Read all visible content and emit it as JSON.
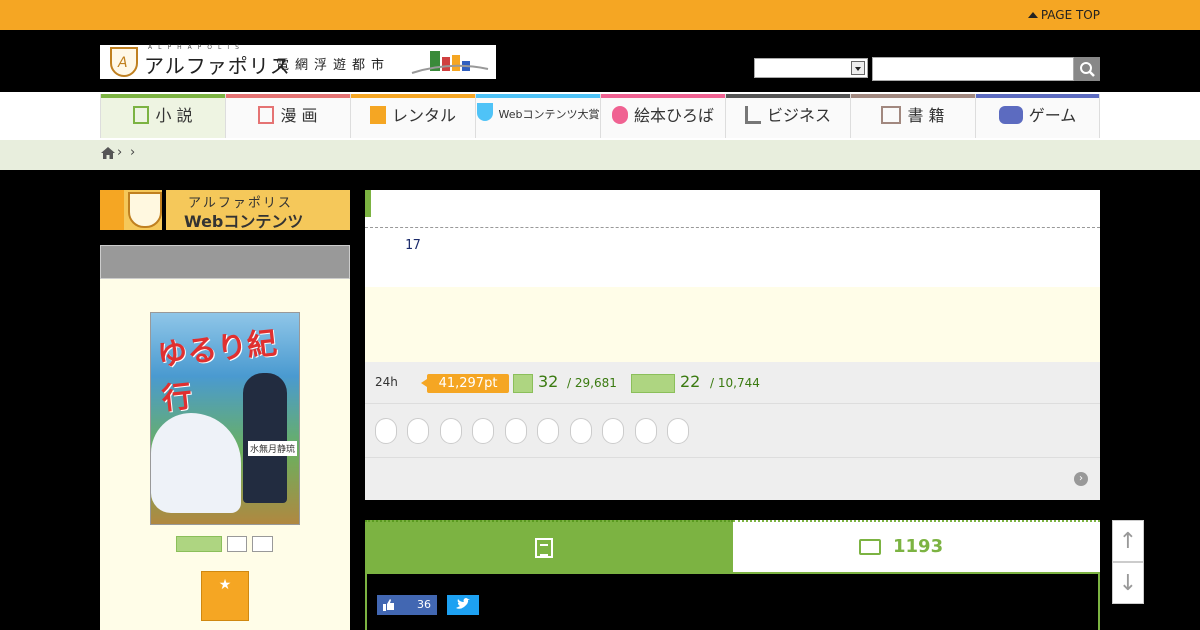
{
  "topbar": {
    "page_top": "PAGE TOP"
  },
  "logo": {
    "name": "アルファポリス",
    "sub": "電網浮遊都市",
    "alpha": "ALPHAPOLIS",
    "emblem_letter": "A"
  },
  "search": {
    "placeholder": "",
    "select_value": ""
  },
  "nav": {
    "items": [
      {
        "label": "小 説",
        "color": "#7cb342",
        "icon": "book-icon"
      },
      {
        "label": "漫 画",
        "color": "#e57373",
        "icon": "manga-icon"
      },
      {
        "label": "レンタル",
        "color": "#f5a623",
        "icon": "rental-icon"
      },
      {
        "label": "Webコンテンツ大賞",
        "color": "#4fc3f7",
        "icon": "trophy-icon"
      },
      {
        "label": "絵本ひろば",
        "color": "#f06292",
        "icon": "picturebook-icon"
      },
      {
        "label": "ビジネス",
        "color": "#555555",
        "icon": "chart-icon"
      },
      {
        "label": "書 籍",
        "color": "#a1887f",
        "icon": "open-book-icon"
      },
      {
        "label": "ゲーム",
        "color": "#5c6bc0",
        "icon": "gamepad-icon"
      }
    ]
  },
  "breadcrumb": {
    "sep1": "›",
    "sep2": "›"
  },
  "sidebar": {
    "banner_line1": "アルファポリス",
    "banner_line2": "Webコンテンツ",
    "cover_title": "ゆるり紀行",
    "cover_author": "水無月静琉",
    "fav_icon": "★"
  },
  "main": {
    "number": "17",
    "stats": {
      "period": "24h",
      "points": "41,297pt",
      "rank1": "32",
      "rank1_total": "/ 29,681",
      "rank2": "22",
      "rank2_total": "/ 10,744"
    },
    "more_icon": "›"
  },
  "tabs": {
    "comments_count": "1193",
    "fb_count": "36"
  },
  "scroll": {
    "up": "↑",
    "down": "↓"
  }
}
